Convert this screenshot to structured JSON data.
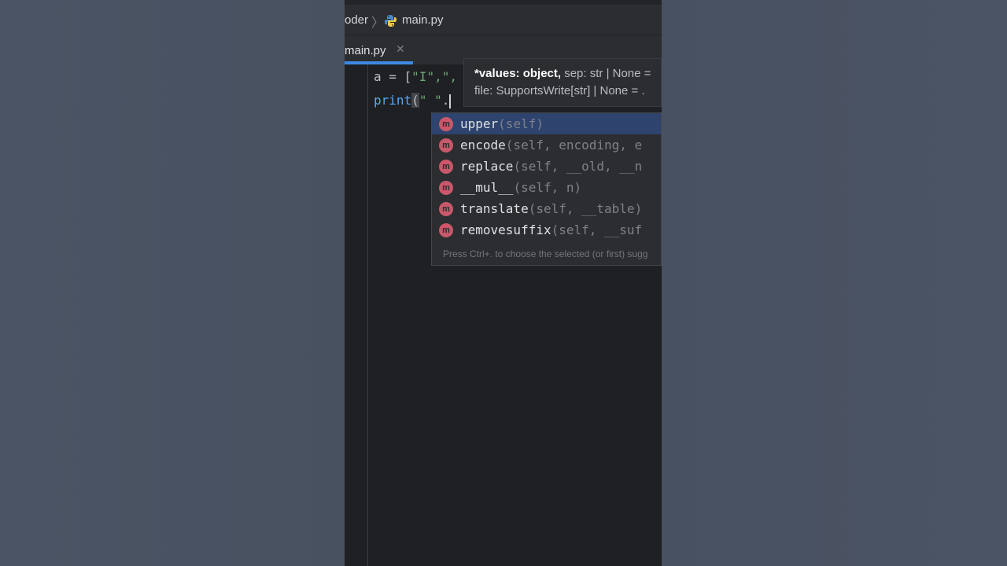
{
  "breadcrumb": {
    "project": "oder",
    "file": "main.py"
  },
  "tabs": [
    {
      "label": "main.py",
      "close": "✕",
      "active": true
    }
  ],
  "code": {
    "line1": {
      "var": "a",
      "op": " = [",
      "s1": "\"I\"",
      "tail": ",\","
    },
    "line2": {
      "fn": "print",
      "open": "(",
      "str": "\" \"",
      "dot": "."
    }
  },
  "param_hint": {
    "bold": "*values: object,",
    "rest": " sep: str | None = ",
    "line2": "file: SupportsWrite[str] | None = ."
  },
  "completion": {
    "items": [
      {
        "name": "upper",
        "signature": "(self)",
        "kind": "m",
        "selected": true
      },
      {
        "name": "encode",
        "signature": "(self, encoding, e",
        "kind": "m",
        "selected": false
      },
      {
        "name": "replace",
        "signature": "(self, __old, __n",
        "kind": "m",
        "selected": false
      },
      {
        "name": "__mul__",
        "signature": "(self, n)",
        "kind": "m",
        "selected": false
      },
      {
        "name": "translate",
        "signature": "(self, __table)",
        "kind": "m",
        "selected": false
      },
      {
        "name": "removesuffix",
        "signature": "(self, __suf",
        "kind": "m",
        "selected": false
      }
    ],
    "footer": "Press Ctrl+. to choose the selected (or first) sugg"
  },
  "colors": {
    "accent": "#3d8ae6",
    "method_icon": "#c7596b",
    "string": "#6aab73",
    "function": "#56a8f5"
  },
  "icons": {
    "file_icon": "python-file-icon",
    "method_icon": "method-icon",
    "close_icon": "close-icon"
  }
}
